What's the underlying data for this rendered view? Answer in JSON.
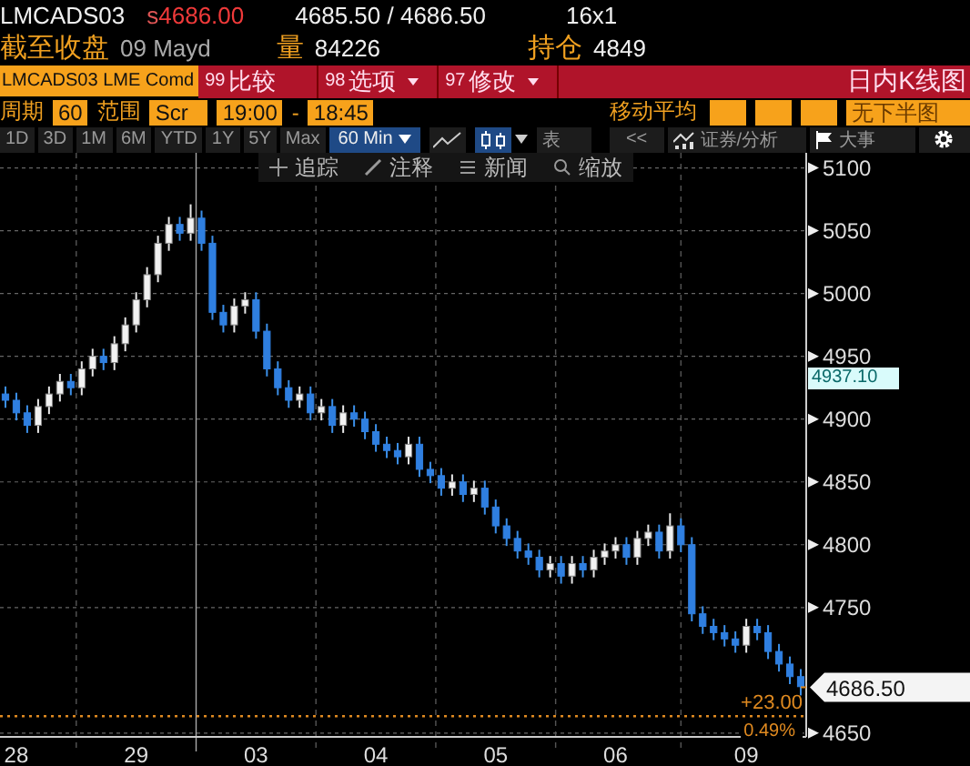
{
  "quote": {
    "ticker": "LMCADS03",
    "source": "s",
    "last": "4686.00",
    "bid_ask": "4685.50 / 4686.50",
    "size": "16x1"
  },
  "info": {
    "close_label": "截至收盘",
    "date": "09 Mayd",
    "volume_label": "量",
    "volume": "84226",
    "oi_label": "持仓",
    "oi": "4849"
  },
  "command_bar": {
    "security": "LMCADS03 LME Comd",
    "menus": [
      {
        "number": "99",
        "label": "比较",
        "dropdown": false
      },
      {
        "number": "98",
        "label": "选项",
        "dropdown": true
      },
      {
        "number": "97",
        "label": "修改",
        "dropdown": true
      }
    ],
    "title": "日内K线图"
  },
  "settings": {
    "period_label": "周期",
    "period": "60",
    "range_label": "范围",
    "range_mode": "Scr",
    "start": "19:00",
    "separator": "-",
    "end": "18:45",
    "ma_label": "移动平均",
    "lower_panel": "无下半图"
  },
  "toolbar": {
    "ranges": [
      {
        "label": "1D",
        "selected": false
      },
      {
        "label": "3D",
        "selected": false
      },
      {
        "label": "1M",
        "selected": false
      },
      {
        "label": "6M",
        "selected": false
      },
      {
        "label": "YTD",
        "selected": false
      },
      {
        "label": "1Y",
        "selected": false
      },
      {
        "label": "5Y",
        "selected": false
      },
      {
        "label": "Max",
        "selected": false
      }
    ],
    "interval": "60 Min",
    "chart_types": [
      {
        "kind": "line",
        "selected": false
      },
      {
        "kind": "candle",
        "selected": true
      }
    ],
    "table": "表",
    "collapse": "<<",
    "analysis": "证券/分析",
    "events": "大事"
  },
  "chart_tools": [
    {
      "kind": "track",
      "label": "追踪"
    },
    {
      "kind": "annotate",
      "label": "注释"
    },
    {
      "kind": "news",
      "label": "新闻"
    },
    {
      "kind": "zoom",
      "label": "缩放"
    }
  ],
  "chart": {
    "chart_data": {
      "type": "candlestick",
      "ylim": [
        4647,
        5112
      ],
      "grid": true,
      "ref_lines": [
        {
          "axis": "y",
          "value": 4663.5
        }
      ],
      "yticks": [
        5100,
        5050,
        5000,
        4950,
        4900,
        4850,
        4800,
        4750,
        4650
      ],
      "categories": [
        null,
        "28",
        null,
        null,
        null,
        null,
        null,
        null,
        null,
        null,
        null,
        null,
        "29",
        null,
        null,
        null,
        null,
        null,
        null,
        null,
        null,
        null,
        null,
        "03",
        null,
        null,
        null,
        null,
        null,
        null,
        null,
        null,
        null,
        null,
        "04",
        null,
        null,
        null,
        null,
        null,
        null,
        null,
        null,
        null,
        null,
        "05",
        null,
        null,
        null,
        null,
        null,
        null,
        null,
        null,
        null,
        null,
        "06",
        null,
        null,
        null,
        null,
        null,
        null,
        null,
        null,
        null,
        null,
        null,
        "09",
        null,
        null,
        null,
        null,
        null
      ],
      "ohlc": [
        [
          4920,
          4926,
          4909,
          4915
        ],
        [
          4915,
          4921,
          4899,
          4905
        ],
        [
          4905,
          4911,
          4889,
          4895
        ],
        [
          4895,
          4916,
          4889,
          4910
        ],
        [
          4910,
          4926,
          4904,
          4920
        ],
        [
          4920,
          4936,
          4914,
          4930
        ],
        [
          4930,
          4936,
          4919,
          4925
        ],
        [
          4925,
          4946,
          4919,
          4940
        ],
        [
          4940,
          4956,
          4934,
          4950
        ],
        [
          4950,
          4956,
          4939,
          4945
        ],
        [
          4945,
          4966,
          4939,
          4960
        ],
        [
          4960,
          4981,
          4954,
          4975
        ],
        [
          4975,
          5001,
          4969,
          4995
        ],
        [
          4995,
          5021,
          4989,
          5015
        ],
        [
          5015,
          5046,
          5009,
          5040
        ],
        [
          5040,
          5061,
          5034,
          5055
        ],
        [
          5055,
          5061,
          5042,
          5048
        ],
        [
          5048,
          5071,
          5042,
          5060
        ],
        [
          5060,
          5066,
          5034,
          5040
        ],
        [
          5040,
          5046,
          4979,
          4985
        ],
        [
          4985,
          4991,
          4969,
          4975
        ],
        [
          4975,
          4996,
          4969,
          4990
        ],
        [
          4990,
          5001,
          4984,
          4995
        ],
        [
          4995,
          5001,
          4964,
          4970
        ],
        [
          4970,
          4976,
          4934,
          4940
        ],
        [
          4940,
          4946,
          4919,
          4925
        ],
        [
          4925,
          4931,
          4909,
          4915
        ],
        [
          4915,
          4926,
          4909,
          4920
        ],
        [
          4920,
          4926,
          4899,
          4905
        ],
        [
          4905,
          4916,
          4899,
          4910
        ],
        [
          4910,
          4916,
          4889,
          4895
        ],
        [
          4895,
          4911,
          4889,
          4905
        ],
        [
          4905,
          4911,
          4894,
          4900
        ],
        [
          4900,
          4906,
          4884,
          4890
        ],
        [
          4890,
          4896,
          4874,
          4880
        ],
        [
          4880,
          4886,
          4869,
          4875
        ],
        [
          4875,
          4881,
          4864,
          4870
        ],
        [
          4870,
          4886,
          4864,
          4880
        ],
        [
          4880,
          4886,
          4854,
          4860
        ],
        [
          4860,
          4866,
          4849,
          4855
        ],
        [
          4855,
          4861,
          4839,
          4845
        ],
        [
          4845,
          4856,
          4839,
          4850
        ],
        [
          4850,
          4856,
          4834,
          4840
        ],
        [
          4840,
          4851,
          4834,
          4845
        ],
        [
          4845,
          4851,
          4824,
          4830
        ],
        [
          4830,
          4836,
          4809,
          4815
        ],
        [
          4815,
          4821,
          4799,
          4805
        ],
        [
          4805,
          4811,
          4789,
          4795
        ],
        [
          4795,
          4801,
          4784,
          4790
        ],
        [
          4790,
          4796,
          4774,
          4780
        ],
        [
          4780,
          4791,
          4774,
          4785
        ],
        [
          4785,
          4791,
          4769,
          4775
        ],
        [
          4775,
          4791,
          4769,
          4785
        ],
        [
          4785,
          4791,
          4774,
          4780
        ],
        [
          4780,
          4796,
          4774,
          4790
        ],
        [
          4790,
          4801,
          4784,
          4795
        ],
        [
          4795,
          4806,
          4789,
          4800
        ],
        [
          4800,
          4806,
          4784,
          4790
        ],
        [
          4790,
          4811,
          4784,
          4805
        ],
        [
          4805,
          4816,
          4799,
          4810
        ],
        [
          4810,
          4816,
          4789,
          4795
        ],
        [
          4795,
          4825,
          4789,
          4815
        ],
        [
          4815,
          4821,
          4794,
          4800
        ],
        [
          4800,
          4806,
          4739,
          4745
        ],
        [
          4745,
          4751,
          4729,
          4735
        ],
        [
          4735,
          4741,
          4724,
          4730
        ],
        [
          4730,
          4736,
          4719,
          4725
        ],
        [
          4725,
          4731,
          4714,
          4720
        ],
        [
          4720,
          4741,
          4714,
          4735
        ],
        [
          4735,
          4741,
          4724,
          4730
        ],
        [
          4730,
          4736,
          4709,
          4715
        ],
        [
          4715,
          4721,
          4699,
          4705
        ],
        [
          4705,
          4711,
          4689,
          4695
        ],
        [
          4695,
          4701,
          4680,
          4687
        ]
      ]
    },
    "moving_average": "4937.10",
    "last_price": "4686.50",
    "change": "+23.00",
    "change_percent": "0.49%"
  }
}
